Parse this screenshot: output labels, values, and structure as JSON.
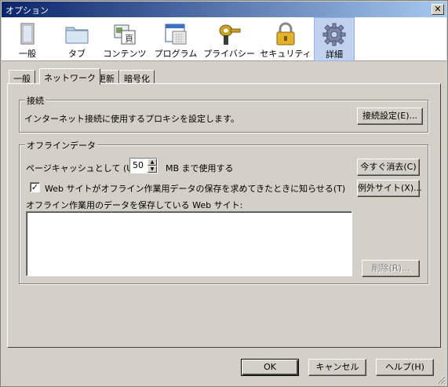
{
  "window": {
    "title": "オプション",
    "close_glyph": "✕"
  },
  "toolbar": {
    "items": [
      {
        "label": "一般",
        "icon": "window-icon"
      },
      {
        "label": "タブ",
        "icon": "folder-tab-icon"
      },
      {
        "label": "コンテンツ",
        "icon": "content-icon"
      },
      {
        "label": "プログラム",
        "icon": "applications-icon"
      },
      {
        "label": "プライバシー",
        "icon": "key-icon"
      },
      {
        "label": "セキュリティ",
        "icon": "lock-icon"
      },
      {
        "label": "詳細",
        "icon": "gear-icon",
        "selected": true
      }
    ]
  },
  "tabs": [
    {
      "label": "一般"
    },
    {
      "label": "ネットワーク",
      "active": true
    },
    {
      "label": "更新"
    },
    {
      "label": "暗号化"
    }
  ],
  "connection": {
    "legend": "接続",
    "description": "インターネット接続に使用するプロキシを設定します。",
    "settings_button": "接続設定(E)..."
  },
  "offline": {
    "legend": "オフラインデータ",
    "cache_label": "ページキャッシュとして (U)",
    "cache_value": "50",
    "cache_unit": "MB まで使用する",
    "clear_button": "今すぐ消去(C)",
    "notify_checked": true,
    "notify_label": "Web サイトがオフライン作業用データの保存を求めてきたときに知らせる(T)",
    "exceptions_button": "例外サイト(X)...",
    "list_label": "オフライン作業用のデータを保存している Web サイト:",
    "delete_button": "削除(R)..."
  },
  "footer": {
    "ok": "OK",
    "cancel": "キャンセル",
    "help": "ヘルプ(H)"
  },
  "colors": {
    "dialog_bg": "#d4d0c8",
    "title_start": "#0a246a",
    "title_end": "#a6caf0",
    "selected_toolbar_bg": "#c1d2ee"
  }
}
